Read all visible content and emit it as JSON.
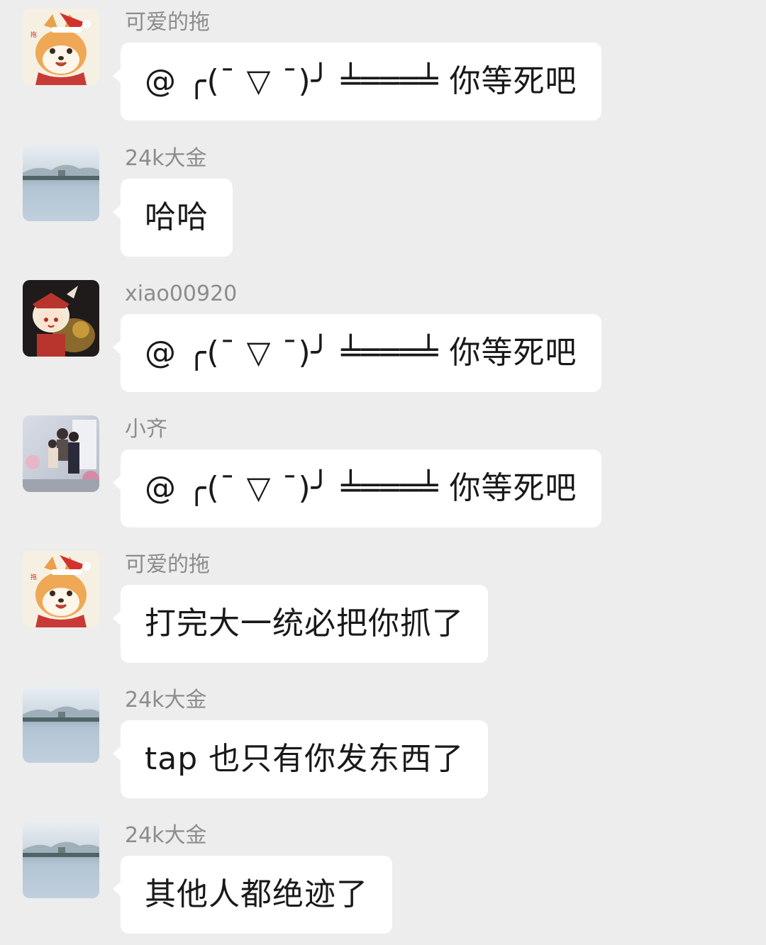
{
  "colors": {
    "background": "#ededed",
    "bubble": "#ffffff",
    "sender_name": "#8c8c8c",
    "message_text": "#191919"
  },
  "messages": [
    {
      "sender": "可爱的拖",
      "avatar": "shiba-dog-santa-hat-avatar",
      "text": "@ ╭(ˉ ▽ ˉ)╯ ╧═══╧ 你等死吧"
    },
    {
      "sender": "24k大金",
      "avatar": "lake-landscape-avatar",
      "text": "哈哈"
    },
    {
      "sender": "xiao00920",
      "avatar": "anime-character-avatar",
      "text": "@ ╭(ˉ ▽ ˉ)╯ ╧═══╧ 你等死吧"
    },
    {
      "sender": "小齐",
      "avatar": "family-photo-avatar",
      "text": "@ ╭(ˉ ▽ ˉ)╯ ╧═══╧ 你等死吧"
    },
    {
      "sender": "可爱的拖",
      "avatar": "shiba-dog-santa-hat-avatar",
      "text": "打完大一统必把你抓了"
    },
    {
      "sender": "24k大金",
      "avatar": "lake-landscape-avatar",
      "text": "tap 也只有你发东西了"
    },
    {
      "sender": "24k大金",
      "avatar": "lake-landscape-avatar",
      "text": "其他人都绝迹了"
    }
  ]
}
